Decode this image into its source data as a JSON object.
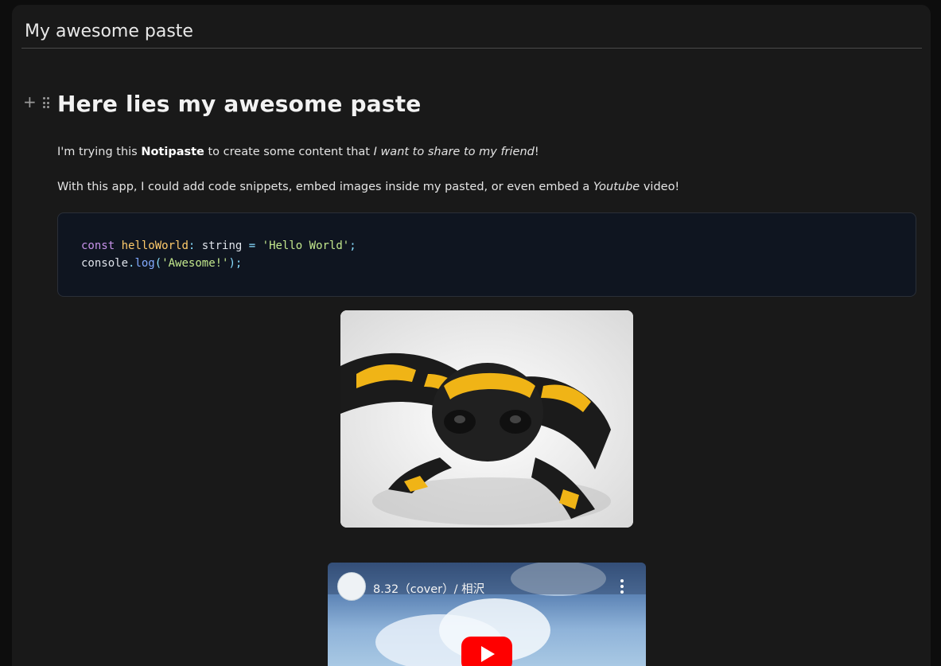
{
  "page": {
    "title": "My awesome paste"
  },
  "editor": {
    "heading": "Here lies my awesome paste",
    "paragraph1": {
      "t1": "I'm trying this ",
      "bold": "Notipaste",
      "t2": " to create some content that ",
      "italic": "I want to share to my friend",
      "t3": "!"
    },
    "paragraph2": {
      "t1": "With this app, I could add code snippets, embed images inside my pasted, or even embed a ",
      "italic": "Youtube",
      "t2": " video!"
    },
    "code": {
      "line1": {
        "kw": "const",
        "sp1": " ",
        "var": "helloWorld",
        "colon": ":",
        "type": " string ",
        "eq": "=",
        "sp2": " ",
        "str": "'Hello World'",
        "semi": ";"
      },
      "line2": {
        "obj": "console",
        "dot": ".",
        "fn": "log",
        "p1": "(",
        "str": "'Awesome!'",
        "p2": ")",
        "semi": ";"
      }
    },
    "image": {
      "subject": "fire salamander photo"
    },
    "video": {
      "title": "8.32（cover）/ 相沢",
      "icons": [
        "more-vertical-icon",
        "play-icon"
      ],
      "brand_color": "#ff0000"
    }
  },
  "handle_icons": [
    "plus-icon",
    "drag-handle-icon"
  ]
}
